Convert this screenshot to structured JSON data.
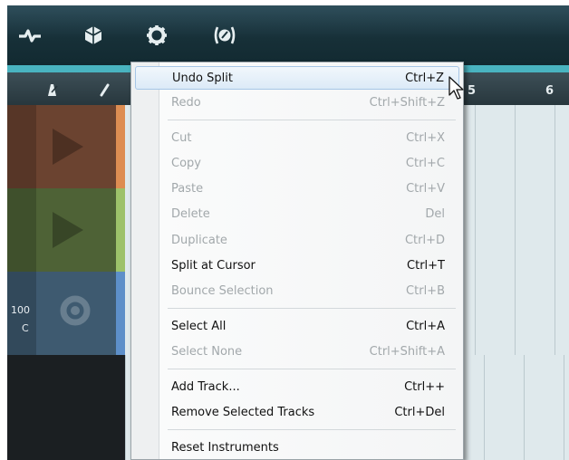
{
  "toolbar": {
    "icons": [
      "waveform-icon",
      "cube-icon",
      "gear-icon",
      "tuner-icon"
    ]
  },
  "ruler": {
    "numbers": [
      "5",
      "6"
    ],
    "tools": [
      "metronome-icon",
      "pencil-icon"
    ]
  },
  "tracks": [
    {
      "name": "audio-track-1",
      "color": "#6b4330",
      "clip_color": "#f0a76a"
    },
    {
      "name": "audio-track-2",
      "color": "#4e6236",
      "clip_color": "#b7d98a"
    },
    {
      "name": "instrument-track-3",
      "color": "#3e5a70",
      "clip_color": "#6d9bd0",
      "value": "100",
      "pan": "C"
    }
  ],
  "menu": {
    "items": [
      {
        "label": "Undo Split",
        "shortcut": "Ctrl+Z",
        "enabled": true,
        "highlighted": true
      },
      {
        "label": "Redo",
        "shortcut": "Ctrl+Shift+Z",
        "enabled": false
      },
      {
        "label": "Cut",
        "shortcut": "Ctrl+X",
        "enabled": false
      },
      {
        "label": "Copy",
        "shortcut": "Ctrl+C",
        "enabled": false
      },
      {
        "label": "Paste",
        "shortcut": "Ctrl+V",
        "enabled": false
      },
      {
        "label": "Delete",
        "shortcut": "Del",
        "enabled": false
      },
      {
        "label": "Duplicate",
        "shortcut": "Ctrl+D",
        "enabled": false
      },
      {
        "label": "Split at Cursor",
        "shortcut": "Ctrl+T",
        "enabled": true
      },
      {
        "label": "Bounce Selection",
        "shortcut": "Ctrl+B",
        "enabled": false
      },
      {
        "label": "Select All",
        "shortcut": "Ctrl+A",
        "enabled": true
      },
      {
        "label": "Select None",
        "shortcut": "Ctrl+Shift+A",
        "enabled": false
      },
      {
        "label": "Add Track...",
        "shortcut": "Ctrl++",
        "enabled": true
      },
      {
        "label": "Remove Selected Tracks",
        "shortcut": "Ctrl+Del",
        "enabled": true
      },
      {
        "label": "Reset Instruments",
        "shortcut": "",
        "enabled": true
      }
    ]
  },
  "colors": {
    "toolbar": "#173038",
    "accent": "#49b3c0",
    "menu_highlight": "#dceaf7",
    "disabled_text": "#a2a8ab"
  }
}
